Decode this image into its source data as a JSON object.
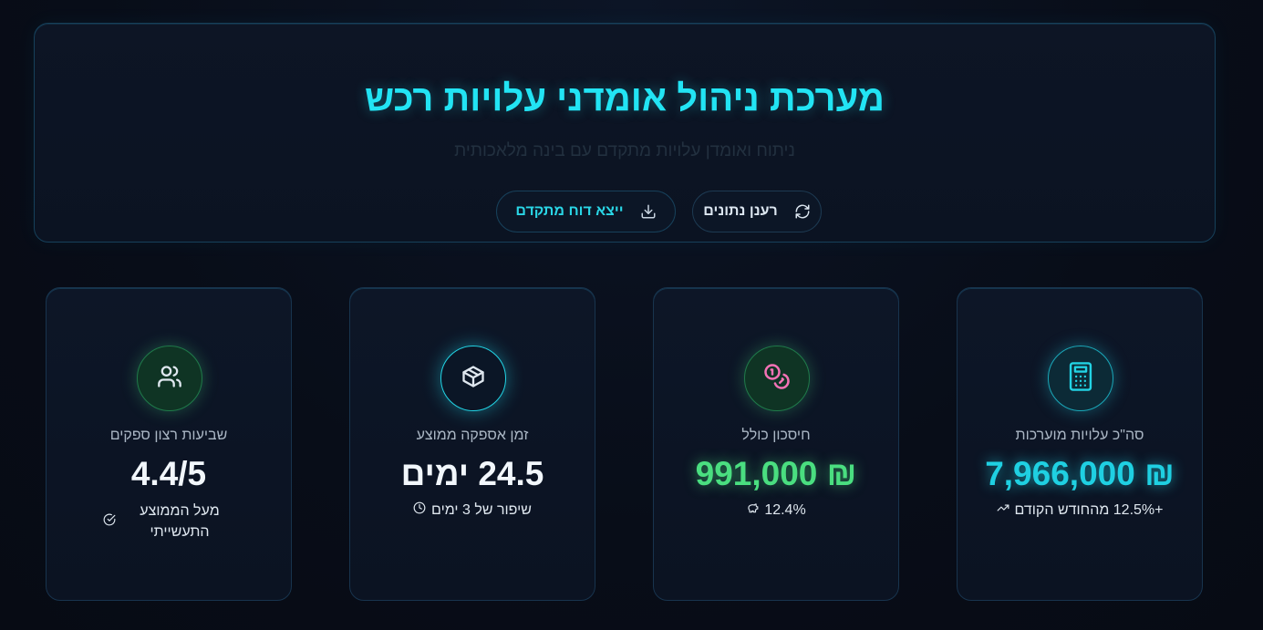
{
  "header": {
    "title": "מערכת ניהול אומדני עלויות רכש",
    "subtitle": "ניתוח ואומדן עלויות מתקדם עם בינה מלאכותית",
    "refresh_label": "רענן נתונים",
    "export_label": "ייצא דוח מתקדם"
  },
  "cards": [
    {
      "label": "סה\"כ עלויות מוערכות",
      "value": "₪ 7,966,000",
      "sub": "+12.5% מהחודש הקודם",
      "icon": "calculator-icon",
      "color": "#22d3e4"
    },
    {
      "label": "חיסכון כולל",
      "value": "₪ 991,000",
      "sub": "12.4%",
      "icon": "coins-icon",
      "color": "#4ade80"
    },
    {
      "label": "זמן אספקה ממוצע",
      "value": "24.5 ימים",
      "sub": "שיפור של 3 ימים",
      "icon": "package-icon",
      "color": "#f2f7fc"
    },
    {
      "label": "שביעות רצון ספקים",
      "value": "4.4/5",
      "sub": "מעל הממוצע התעשייתי",
      "icon": "users-icon",
      "color": "#f2f7fc"
    }
  ]
}
